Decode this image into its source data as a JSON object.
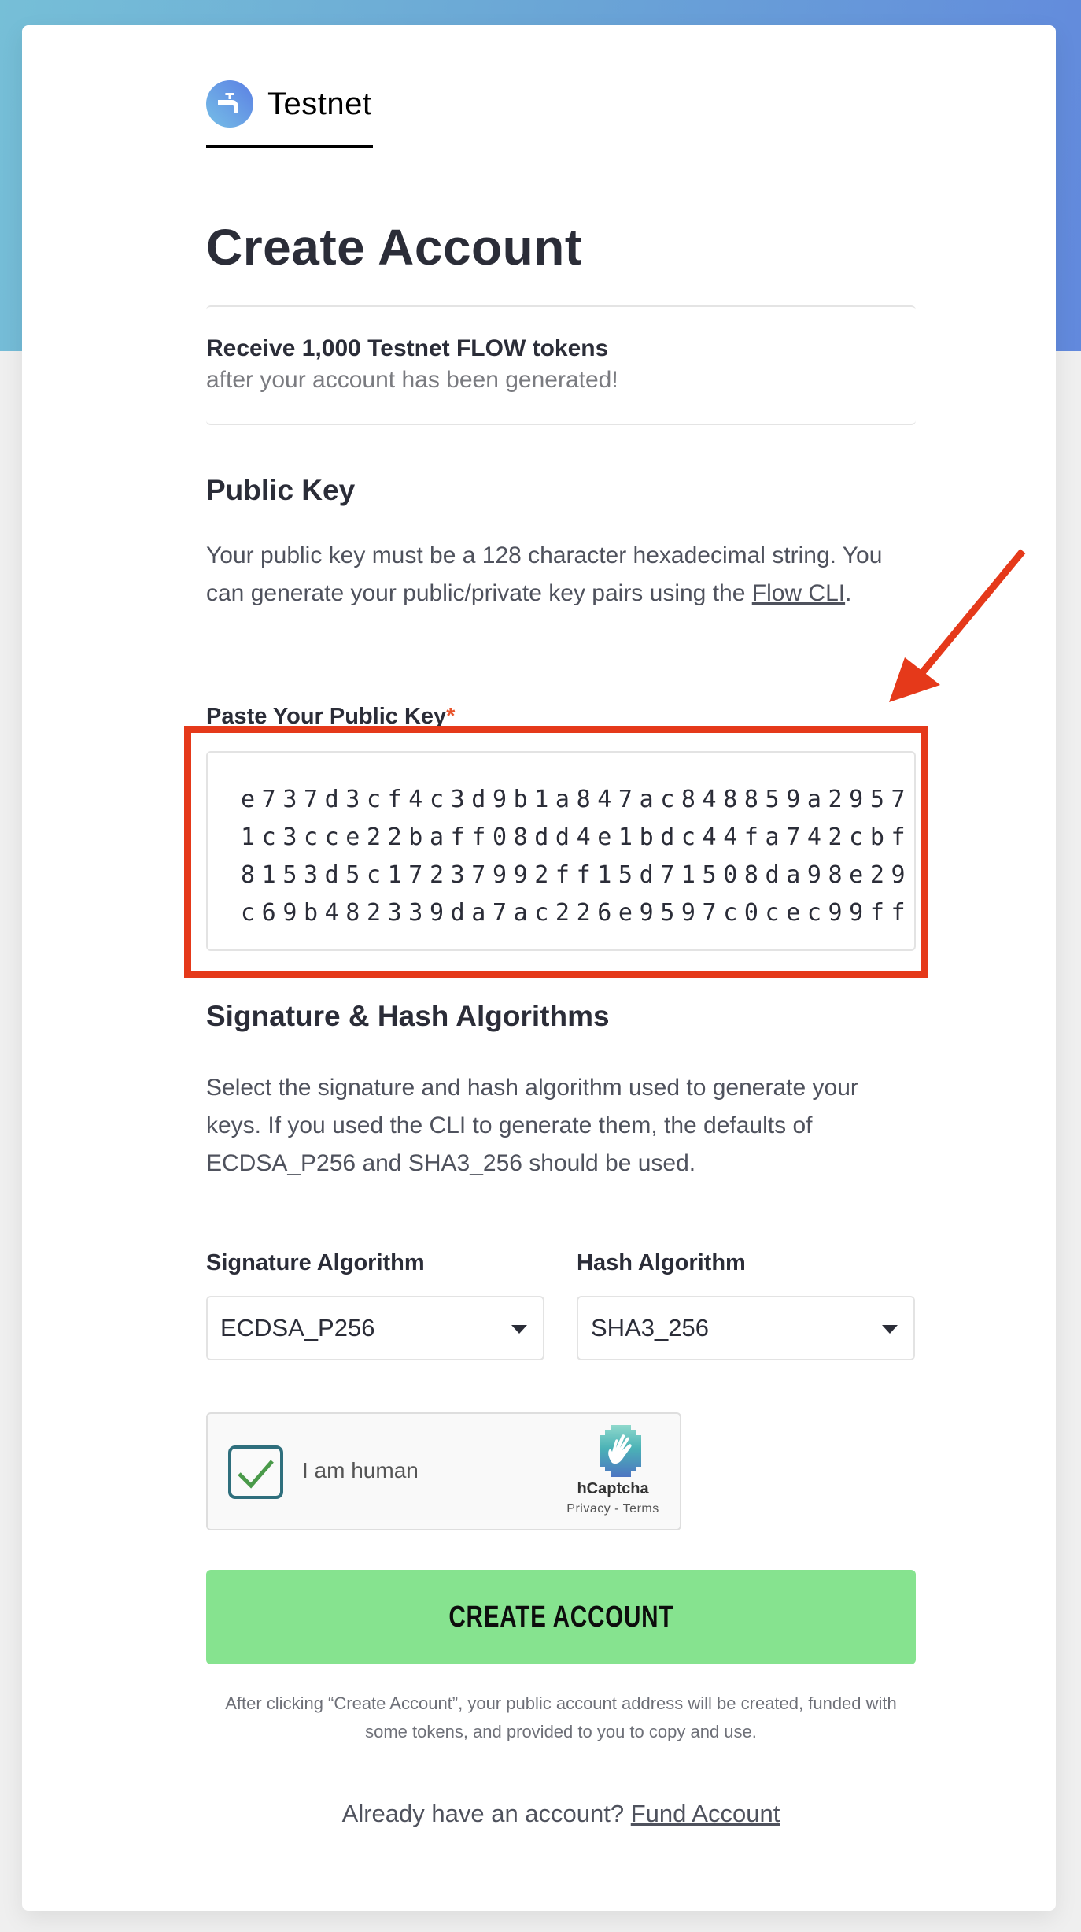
{
  "brand": {
    "name": "Testnet",
    "icon": "faucet-icon"
  },
  "page": {
    "title": "Create Account"
  },
  "info": {
    "title": "Receive 1,000 Testnet FLOW tokens",
    "subtitle": "after your account has been generated!"
  },
  "public_key_section": {
    "heading": "Public Key",
    "description_1": "Your public key must be a 128 character hexadecimal string. You can generate your public/private key pairs using the ",
    "link": "Flow CLI",
    "description_2": ".",
    "field_label": "Paste Your Public Key",
    "required_mark": "*",
    "value_lines": [
      "e737d3cf4c3d9b1a847ac848859a2957",
      "1c3cce22baff08dd4e1bdc44fa742cbf",
      "8153d5c17237992ff15d71508da98e29",
      "c69b482339da7ac226e9597c0cec99ff"
    ]
  },
  "algorithms_section": {
    "heading": "Signature & Hash Algorithms",
    "description": "Select the signature and hash algorithm used to generate your keys. If you used the CLI to generate them, the defaults of ECDSA_P256 and SHA3_256 should be used.",
    "signature": {
      "label": "Signature Algorithm",
      "value": "ECDSA_P256"
    },
    "hash": {
      "label": "Hash Algorithm",
      "value": "SHA3_256"
    }
  },
  "captcha": {
    "label": "I am human",
    "checked": true,
    "provider": "hCaptcha",
    "links": "Privacy - Terms"
  },
  "actions": {
    "create_label": "CREATE ACCOUNT",
    "note": "After clicking “Create Account”, your public account address will be created, funded with some tokens, and provided to you to copy and use.",
    "footer_prompt": "Already have an account? ",
    "footer_link": "Fund Account"
  },
  "annotation": {
    "color": "#e5391a"
  },
  "colors": {
    "button": "#86e38f",
    "required": "#e8542c",
    "checkbox_border": "#2f6f7d",
    "check": "#4a9a4a"
  }
}
